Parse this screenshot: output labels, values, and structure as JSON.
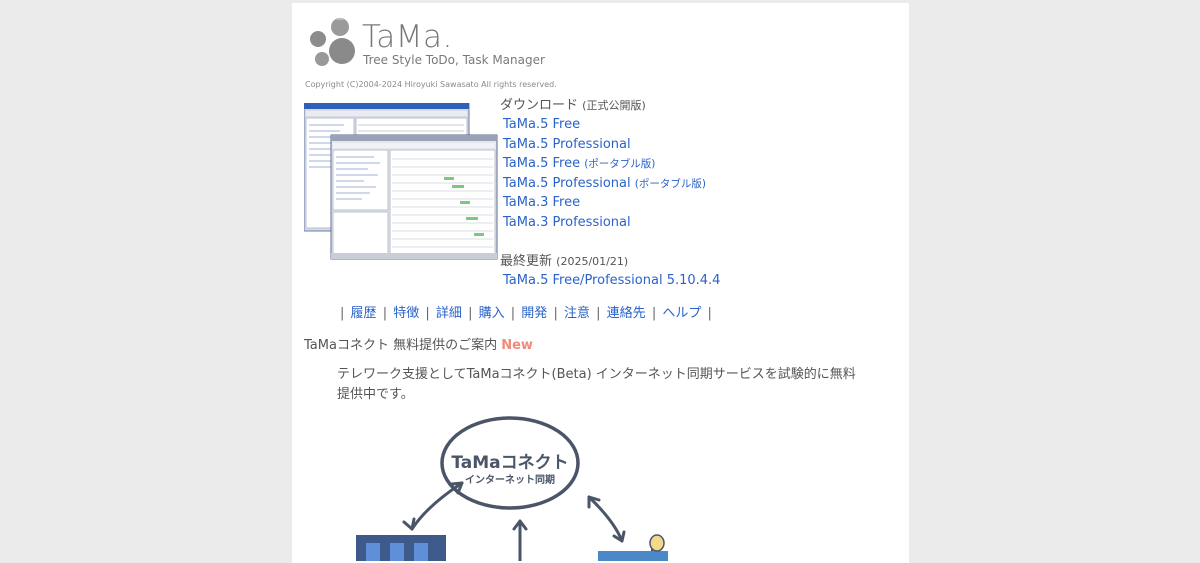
{
  "brand": {
    "title": "TaMa.",
    "subtitle": "Tree Style ToDo, Task Manager",
    "copyright": "Copyright (C)2004-2024 Hiroyuki Sawasato All rights reserved."
  },
  "download": {
    "heading": "ダウンロード",
    "heading_note": "(正式公開版)",
    "links": [
      {
        "label": "TaMa.5 Free",
        "note": ""
      },
      {
        "label": "TaMa.5 Professional",
        "note": ""
      },
      {
        "label": "TaMa.5 Free",
        "note": "(ポータブル版)"
      },
      {
        "label": "TaMa.5 Professional",
        "note": "(ポータブル版)"
      },
      {
        "label": "TaMa.3 Free",
        "note": ""
      },
      {
        "label": "TaMa.3 Professional",
        "note": ""
      }
    ]
  },
  "update": {
    "heading": "最終更新",
    "date": "(2025/01/21)",
    "link": "TaMa.5 Free/Professional 5.10.4.4"
  },
  "nav": {
    "separator": "|",
    "items": [
      "履歴",
      "特徴",
      "詳細",
      "購入",
      "開発",
      "注意",
      "連絡先",
      "ヘルプ"
    ]
  },
  "connect": {
    "heading": "TaMaコネクト 無料提供のご案内",
    "badge": "New",
    "text": "テレワーク支援としてTaMaコネクト(Beta) インターネット同期サービスを試験的に無料提供中です。",
    "illustration_title": "TaMaコネクト",
    "illustration_subtitle": "インターネット同期"
  },
  "colors": {
    "link": "#2a63c9",
    "badge": "#f08a7a",
    "page_bg": "#ebebeb"
  }
}
